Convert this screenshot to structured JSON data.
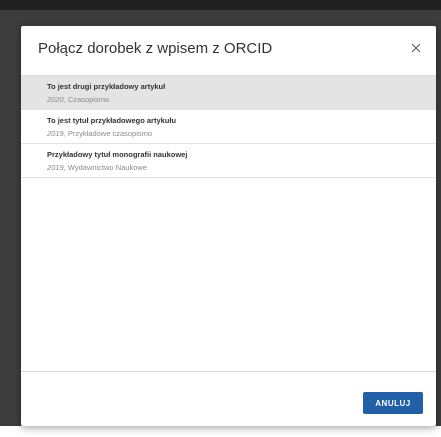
{
  "dialog": {
    "title": "Połącz dorobek z wpisem z ORCID",
    "close_icon": "close-icon",
    "items": [
      {
        "title": "To jest drugi przykładowy artykuł",
        "year": "2020",
        "source": "Czasopismo",
        "selected": true
      },
      {
        "title": "To jest tytuł przykładowego artykułu",
        "year": "2019",
        "source": "Przykładowe czasopismo",
        "selected": false
      },
      {
        "title": "Przykładowy tytuł monografii naukowej",
        "year": "2019",
        "source": "Wydawnictwo Naukowe",
        "selected": false
      }
    ],
    "cancel_label": "ANULUJ"
  },
  "colors": {
    "accent": "#2160a8",
    "selected_row": "#e4e4e4",
    "backdrop": "#3c3c3c"
  }
}
